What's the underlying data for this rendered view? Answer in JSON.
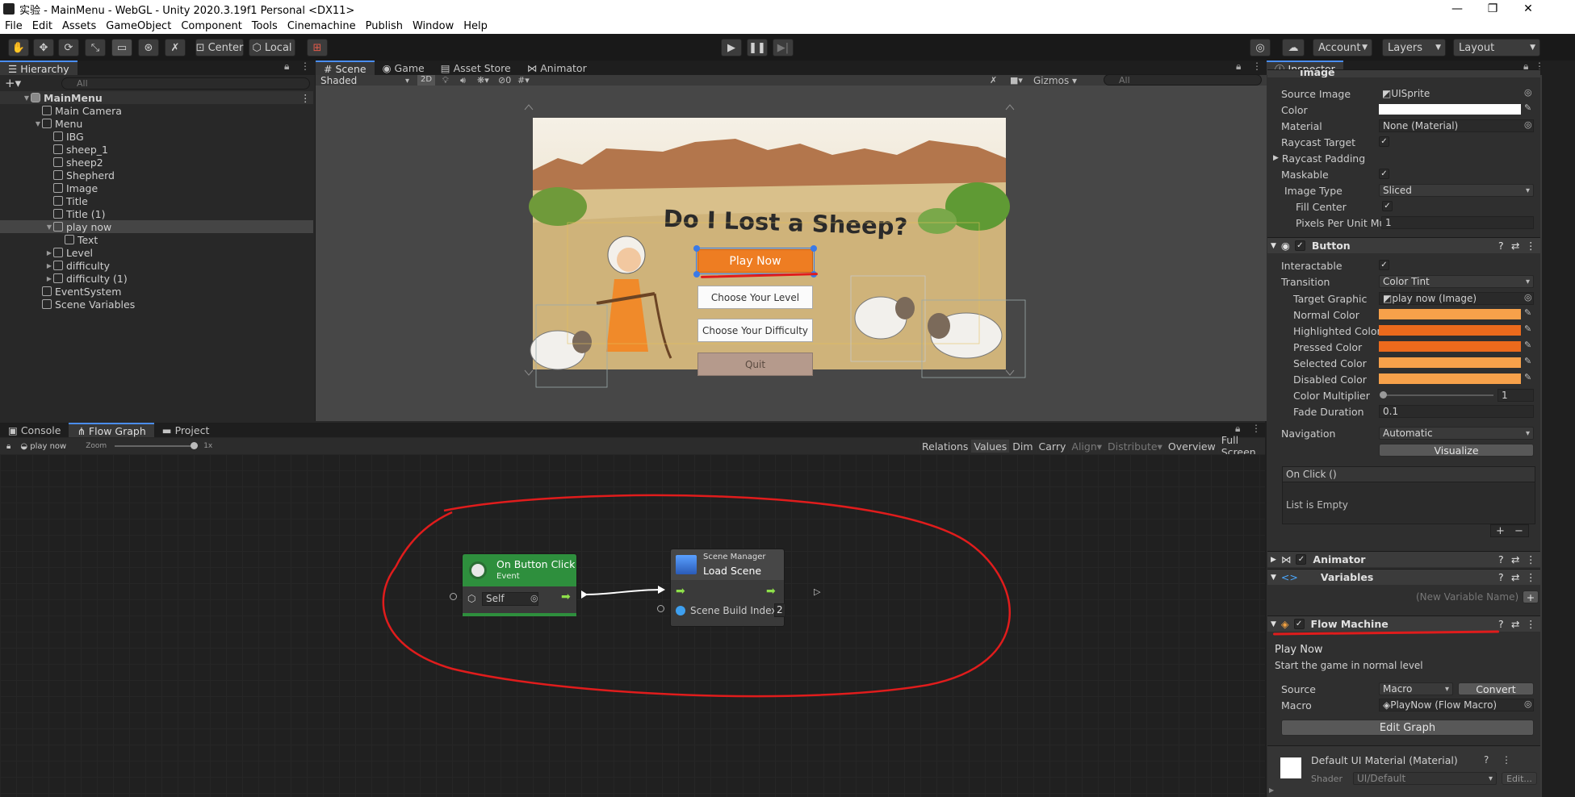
{
  "window": {
    "title": "实验 - MainMenu - WebGL - Unity 2020.3.19f1 Personal <DX11>",
    "controls": [
      "—",
      "❐",
      "✕"
    ]
  },
  "menu": [
    "File",
    "Edit",
    "Assets",
    "GameObject",
    "Component",
    "Tools",
    "Cinemachine",
    "Publish",
    "Window",
    "Help"
  ],
  "toolbar": {
    "pivot": "Center",
    "space": "Local",
    "account": "Account",
    "layers": "Layers",
    "layout": "Layout"
  },
  "hierarchy": {
    "tab": "Hierarchy",
    "search_placeholder": "All",
    "items": [
      {
        "label": "MainMenu",
        "depth": 0,
        "arrow": "▼",
        "kind": "scene"
      },
      {
        "label": "Main Camera",
        "depth": 1,
        "arrow": "",
        "kind": "obj"
      },
      {
        "label": "Menu",
        "depth": 1,
        "arrow": "▼",
        "kind": "obj"
      },
      {
        "label": "IBG",
        "depth": 2,
        "arrow": "",
        "kind": "obj"
      },
      {
        "label": "sheep_1",
        "depth": 2,
        "arrow": "",
        "kind": "obj"
      },
      {
        "label": "sheep2",
        "depth": 2,
        "arrow": "",
        "kind": "obj"
      },
      {
        "label": "Shepherd",
        "depth": 2,
        "arrow": "",
        "kind": "obj"
      },
      {
        "label": "Image",
        "depth": 2,
        "arrow": "",
        "kind": "obj"
      },
      {
        "label": "Title",
        "depth": 2,
        "arrow": "",
        "kind": "obj"
      },
      {
        "label": "Title (1)",
        "depth": 2,
        "arrow": "",
        "kind": "obj"
      },
      {
        "label": "play now",
        "depth": 2,
        "arrow": "▼",
        "kind": "obj",
        "selected": true
      },
      {
        "label": "Text",
        "depth": 3,
        "arrow": "",
        "kind": "obj"
      },
      {
        "label": "Level",
        "depth": 2,
        "arrow": "▶",
        "kind": "obj"
      },
      {
        "label": "difficulty",
        "depth": 2,
        "arrow": "▶",
        "kind": "obj"
      },
      {
        "label": "difficulty (1)",
        "depth": 2,
        "arrow": "▶",
        "kind": "obj"
      },
      {
        "label": "EventSystem",
        "depth": 1,
        "arrow": "",
        "kind": "obj"
      },
      {
        "label": "Scene Variables",
        "depth": 1,
        "arrow": "",
        "kind": "obj"
      }
    ]
  },
  "scene": {
    "tabs": [
      "Scene",
      "Game",
      "Asset Store",
      "Animator"
    ],
    "shading": "Shaded",
    "mode2d": "2D",
    "fx_count": "0",
    "gizmos": "Gizmos",
    "search_placeholder": "All",
    "game_title": "Do I Lost a Sheep?",
    "buttons": [
      "Play Now",
      "Choose Your Level",
      "Choose Your Difficulty",
      "Quit"
    ]
  },
  "bottom": {
    "tabs": [
      "Console",
      "Flow Graph",
      "Project"
    ],
    "breadcrumb": "play now",
    "zoom_label": "Zoom",
    "zoom_value": "1x",
    "graph_buttons": [
      "Relations",
      "Values",
      "Dim",
      "Carry",
      "Align",
      "Distribute",
      "Overview",
      "Full Screen"
    ],
    "node1": {
      "title": "On Button Click",
      "subtitle": "Event",
      "field": "Self"
    },
    "node2": {
      "category": "Scene Manager",
      "title": "Load Scene",
      "port_label": "Scene Build Index",
      "port_value": "2"
    }
  },
  "inspector": {
    "tab": "Inspector",
    "image": {
      "header": "Image",
      "source_image_label": "Source Image",
      "source_image": "UISprite",
      "color_label": "Color",
      "material_label": "Material",
      "material": "None (Material)",
      "raycast_target": "Raycast Target",
      "raycast_padding": "Raycast Padding",
      "maskable": "Maskable",
      "image_type_label": "Image Type",
      "image_type": "Sliced",
      "fill_center": "Fill Center",
      "ppu_label": "Pixels Per Unit Mul",
      "ppu": "1"
    },
    "button": {
      "header": "Button",
      "interactable": "Interactable",
      "transition_label": "Transition",
      "transition": "Color Tint",
      "target_graphic_label": "Target Graphic",
      "target_graphic": "play now (Image)",
      "normal": "Normal Color",
      "highlighted": "Highlighted Color",
      "pressed": "Pressed Color",
      "selected": "Selected Color",
      "disabled": "Disabled Color",
      "multiplier_label": "Color Multiplier",
      "multiplier": "1",
      "fade_label": "Fade Duration",
      "fade": "0.1",
      "navigation_label": "Navigation",
      "navigation": "Automatic",
      "visualize": "Visualize",
      "onclick": "On Click ()",
      "list_empty": "List is Empty"
    },
    "animator": "Animator",
    "variables": "Variables",
    "new_var_placeholder": "(New Variable Name)",
    "flow": {
      "header": "Flow Machine",
      "title": "Play Now",
      "description": "Start the game in normal level",
      "source_label": "Source",
      "source": "Macro",
      "convert": "Convert",
      "macro_label": "Macro",
      "macro": "PlayNow (Flow Macro)",
      "edit_graph": "Edit Graph"
    },
    "material": {
      "name": "Default UI Material (Material)",
      "shader_label": "Shader",
      "shader": "UI/Default",
      "edit": "Edit..."
    }
  },
  "colors": {
    "accent": "#4a8df0",
    "orange": "#f7a14a",
    "orange_dark": "#ec6a1c",
    "annotation": "#e01c1c",
    "node_green": "#2e8f3d"
  }
}
